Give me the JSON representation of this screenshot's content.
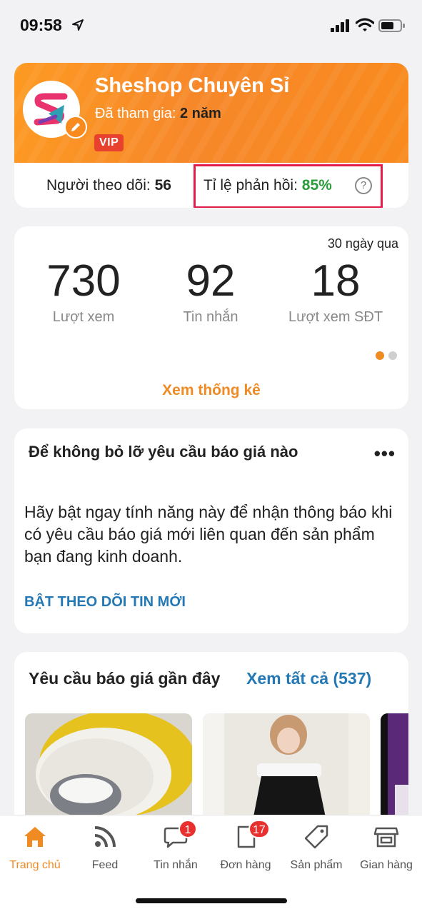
{
  "status_bar": {
    "time": "09:58"
  },
  "profile": {
    "shop_name": "Sheshop Chuyên Sỉ",
    "joined_label": "Đã tham gia:",
    "joined_value": "2 năm",
    "vip_badge": "VIP",
    "followers_label": "Người theo dõi:",
    "followers_value": "56",
    "reply_rate_label": "Tỉ lệ phản hồi:",
    "reply_rate_value": "85%",
    "help_icon": "question-circle-icon"
  },
  "stats": {
    "period": "30 ngày qua",
    "items": [
      {
        "value": "730",
        "label": "Lượt xem"
      },
      {
        "value": "92",
        "label": "Tin nhắn"
      },
      {
        "value": "18",
        "label": "Lượt xem SĐT"
      }
    ],
    "link": "Xem thống kê",
    "active_page": 1,
    "page_count": 2
  },
  "notice": {
    "title": "Để không bỏ lỡ yêu cầu báo giá nào",
    "body": "Hãy bật ngay tính năng này để nhận thông báo khi có yêu cầu báo giá mới liên quan đến sản phẩm bạn đang kinh doanh.",
    "action": "BẬT THEO DÕI TIN MỚI"
  },
  "requests": {
    "title": "Yêu cầu báo giá gần đây",
    "view_all": "Xem tất cả (537)"
  },
  "tabbar": {
    "items": [
      {
        "label": "Trang chủ",
        "icon": "home-icon",
        "active": true
      },
      {
        "label": "Feed",
        "icon": "rss-icon"
      },
      {
        "label": "Tin nhắn",
        "icon": "chat-icon",
        "badge": "1"
      },
      {
        "label": "Đơn hàng",
        "icon": "order-icon",
        "badge": "17"
      },
      {
        "label": "Sản phẩm",
        "icon": "tag-icon"
      },
      {
        "label": "Gian hàng",
        "icon": "store-icon"
      }
    ]
  },
  "colors": {
    "accent": "#f08a23",
    "link": "#2479b5",
    "reply_rate": "#2a9d3a",
    "highlight_box": "#e31d4a",
    "badge": "#e8312e"
  }
}
